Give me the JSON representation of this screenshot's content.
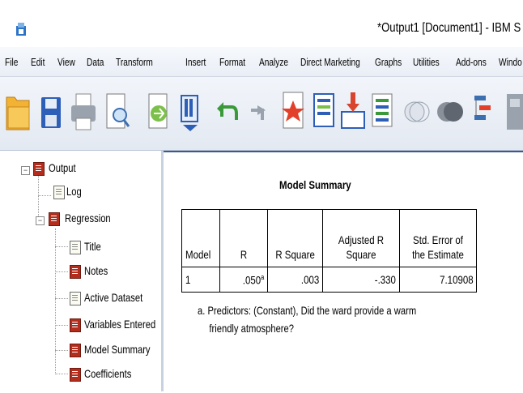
{
  "window": {
    "title": "*Output1 [Document1] - IBM S"
  },
  "menu": [
    "File",
    "Edit",
    "View",
    "Data",
    "Transform",
    "Insert",
    "Format",
    "Analyze",
    "Direct Marketing",
    "Graphs",
    "Utilities",
    "Add-ons",
    "Windo"
  ],
  "toolbar": [
    "open-icon",
    "save-icon",
    "print-icon",
    "print-preview-icon",
    "export-icon",
    "recall-dialog-icon",
    "undo-icon",
    "redo-icon",
    "goto-data-icon",
    "goto-case-icon",
    "goto-variable-icon",
    "variables-icon",
    "circle-icon",
    "dark-circle-icon",
    "designate-window-icon",
    "show-all-icon"
  ],
  "tree": {
    "output": "Output",
    "log": "Log",
    "regression": "Regression",
    "title": "Title",
    "notes": "Notes",
    "active_dataset": "Active Dataset",
    "variables_entered": "Variables Entered",
    "model_summary": "Model Summary",
    "coefficients": "Coefficients"
  },
  "model_summary": {
    "title": "Model Summary",
    "headers": {
      "model": "Model",
      "r": "R",
      "r_square": "R Square",
      "adj_r_square": "Adjusted R Square",
      "std_error": "Std. Error of the Estimate"
    },
    "row": {
      "model": "1",
      "r": ".050",
      "r_sup": "a",
      "r_square": ".003",
      "adj_r_square": "-.330",
      "std_error": "7.10908"
    },
    "footnote_line1": "a. Predictors: (Constant), Did the ward provide a warm",
    "footnote_line2": "friendly atmosphere?"
  }
}
